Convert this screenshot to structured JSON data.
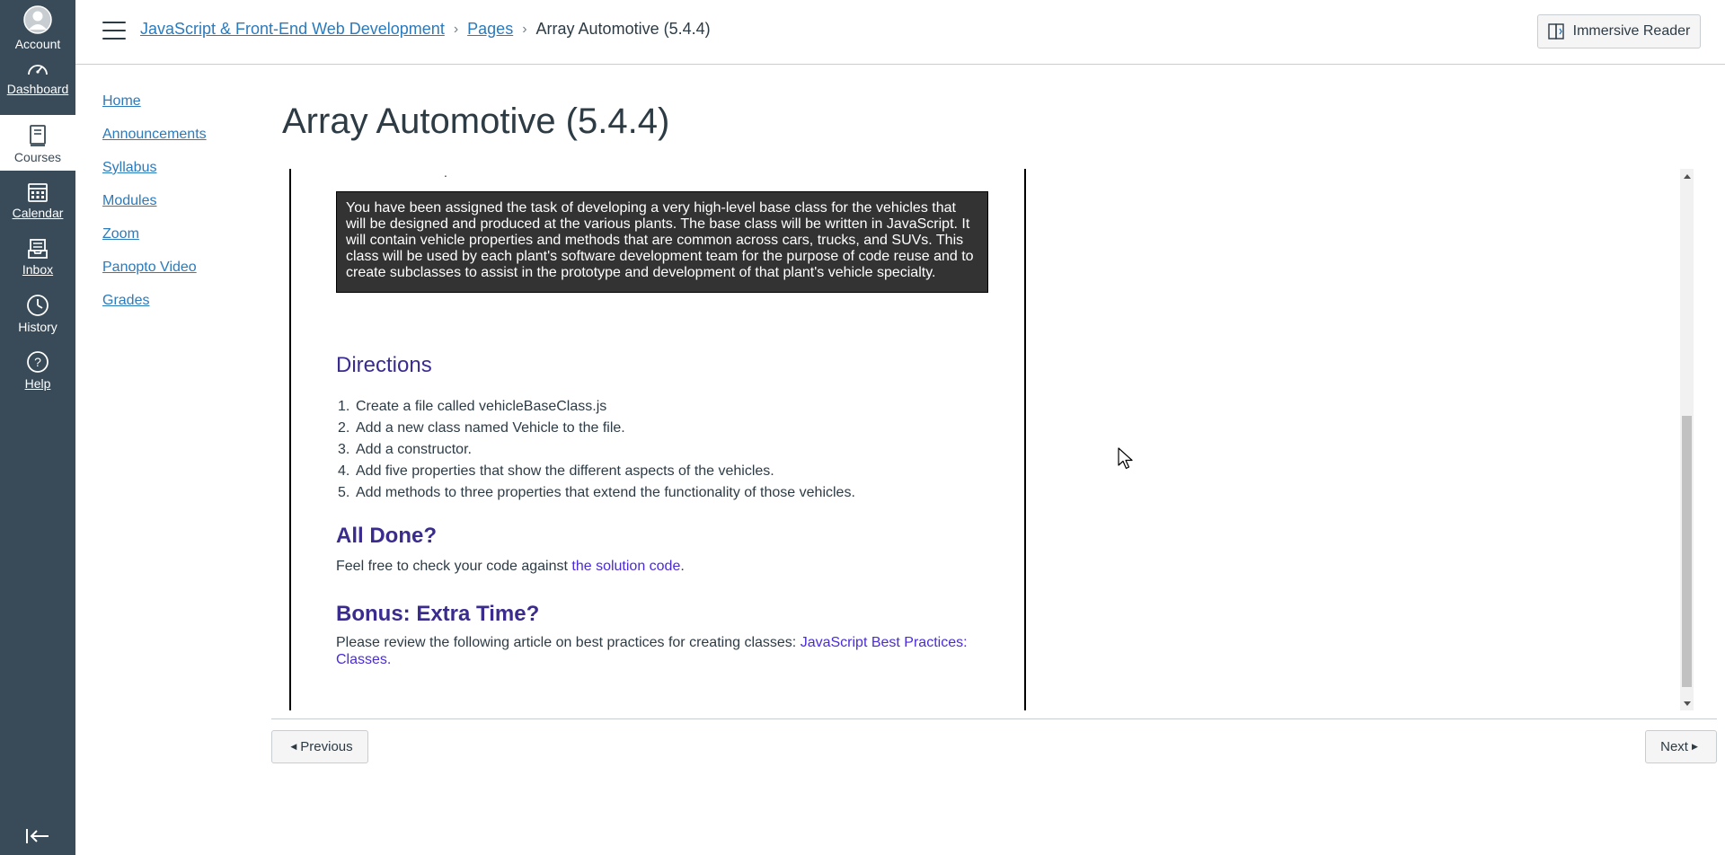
{
  "global_nav": {
    "account": "Account",
    "dashboard": "Dashboard",
    "courses": "Courses",
    "calendar": "Calendar",
    "inbox": "Inbox",
    "history": "History",
    "help": "Help"
  },
  "header": {
    "breadcrumb": {
      "course": "JavaScript & Front-End Web Development",
      "pages": "Pages",
      "current": "Array Automotive (5.4.4)"
    },
    "immersive_reader": "Immersive Reader"
  },
  "course_nav": {
    "items": [
      "Home",
      "Announcements",
      "Syllabus",
      "Modules",
      "Zoom",
      "Panopto Video",
      "Grades"
    ]
  },
  "page": {
    "title": "Array Automotive (5.4.4)",
    "dot": ".",
    "callout": "You have been assigned the task of developing a very high-level base class for the vehicles that will be designed and produced at the various plants. The base class will be written in JavaScript. It will contain vehicle properties and methods that are common across cars, trucks, and SUVs. This class will be used by each plant's software development team for the purpose of code reuse and to create subclasses to assist in the prototype and development of that plant's vehicle specialty.",
    "directions_heading": "Directions",
    "directions": [
      "Create a file called vehicleBaseClass.js",
      "Add a new class named Vehicle to the file.",
      "Add a constructor.",
      "Add five properties that show the different aspects of the vehicles.",
      "Add methods to three properties that extend the functionality of those vehicles."
    ],
    "directions_numbers": [
      "1.",
      "2.",
      "3.",
      "4.",
      "5."
    ],
    "all_done_heading": "All Done?",
    "all_done_text": "Feel free to check your code against ",
    "all_done_link": "the solution code",
    "all_done_end": ".",
    "bonus_heading": "Bonus: Extra Time?",
    "bonus_text": "Please review the following article on best practices for creating classes: ",
    "bonus_link": "JavaScript Best Practices: Classes",
    "bonus_end": "."
  },
  "footer": {
    "previous": "Previous",
    "next": "Next"
  },
  "colors": {
    "nav_bg": "#394b58",
    "link": "#2b7abc",
    "heading": "#3a2c8f",
    "content_link": "#4b2bd8",
    "callout_bg": "#333333"
  }
}
